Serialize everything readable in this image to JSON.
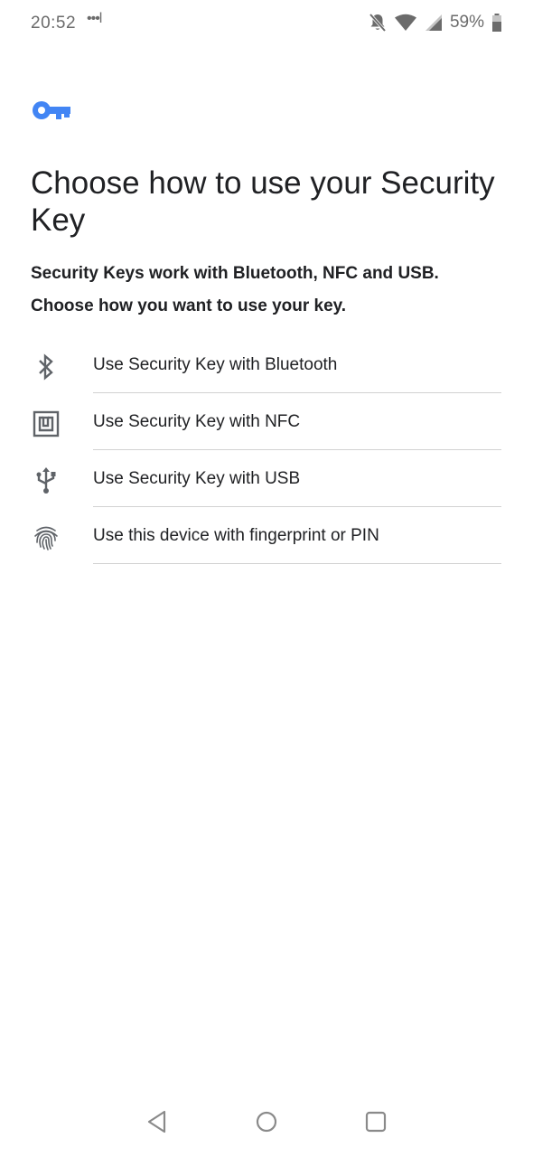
{
  "status_bar": {
    "time": "20:52",
    "notification_dots": "•••l",
    "battery_percent": "59%",
    "icons": [
      "notifications-off-icon",
      "wifi-icon",
      "cellular-signal-icon",
      "battery-icon"
    ]
  },
  "header": {
    "icon": "key-icon",
    "accent_color": "#4285F4",
    "title": "Choose how to use your Security Key",
    "subtitle": "Security Keys work with Bluetooth, NFC and USB. Choose how you want to use your key."
  },
  "options": [
    {
      "icon": "bluetooth-icon",
      "label": "Use Security Key with Bluetooth"
    },
    {
      "icon": "nfc-icon",
      "label": "Use Security Key with NFC"
    },
    {
      "icon": "usb-icon",
      "label": "Use Security Key with USB"
    },
    {
      "icon": "fingerprint-icon",
      "label": "Use this device with fingerprint or PIN"
    }
  ],
  "nav_bar": {
    "icons": [
      "back-icon",
      "home-icon",
      "recents-icon"
    ]
  }
}
